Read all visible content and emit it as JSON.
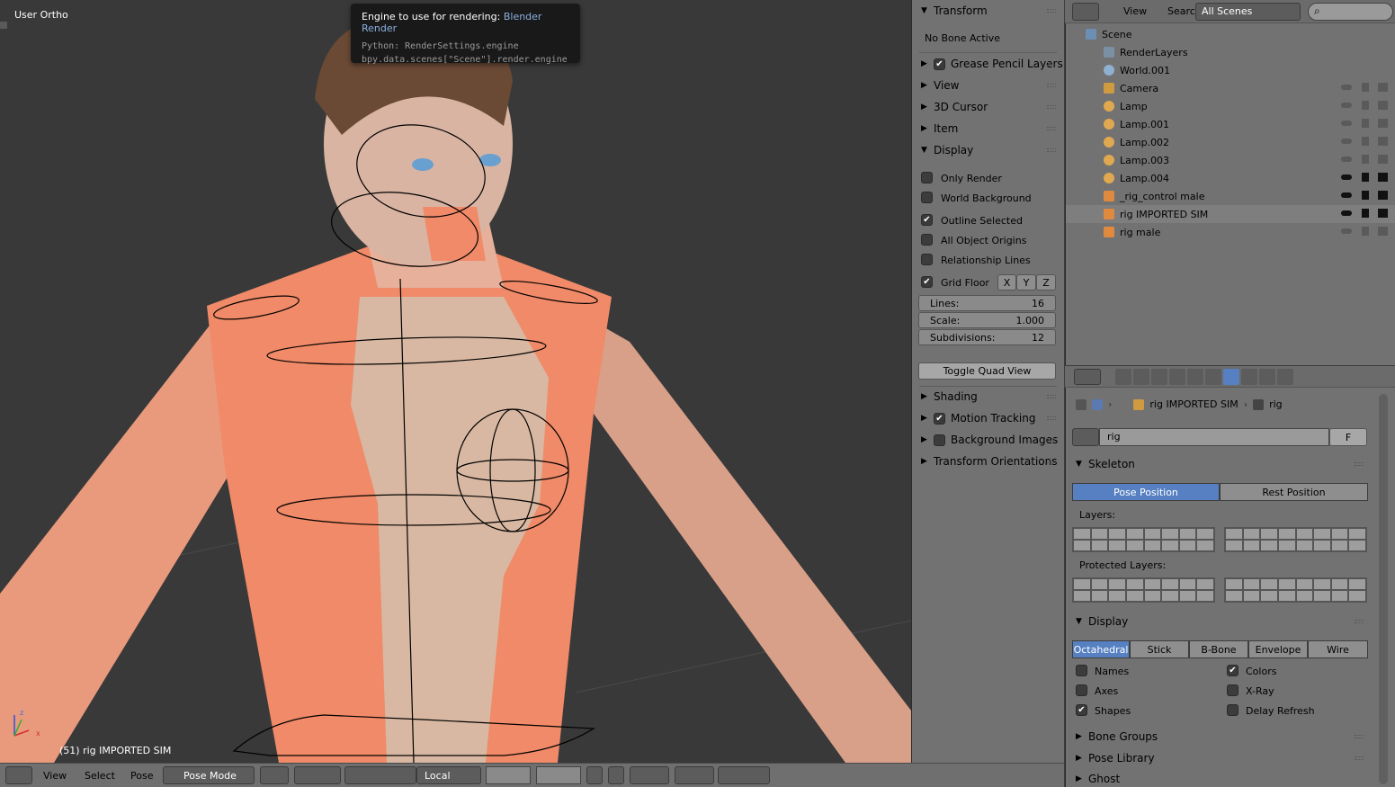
{
  "viewport": {
    "view_label": "User Ortho",
    "status": "(51) rig IMPORTED SIM"
  },
  "tooltip": {
    "title": "Engine to use for rendering:",
    "value": "Blender Render",
    "python1": "Python: RenderSettings.engine",
    "python2": "bpy.data.scenes[\"Scene\"].render.engine"
  },
  "npanel": {
    "transform": "Transform",
    "no_bone": "No Bone Active",
    "grease": "Grease Pencil Layers",
    "view": "View",
    "cursor": "3D Cursor",
    "item": "Item",
    "display": "Display",
    "only_render": "Only Render",
    "world_bg": "World Background",
    "outline_sel": "Outline Selected",
    "all_origins": "All Object Origins",
    "rel_lines": "Relationship Lines",
    "grid_floor": "Grid Floor",
    "axis_x": "X",
    "axis_y": "Y",
    "axis_z": "Z",
    "lines_label": "Lines:",
    "lines_val": "16",
    "scale_label": "Scale:",
    "scale_val": "1.000",
    "subdiv_label": "Subdivisions:",
    "subdiv_val": "12",
    "toggle_quad": "Toggle Quad View",
    "shading": "Shading",
    "motion": "Motion Tracking",
    "bg_images": "Background Images",
    "trans_orient": "Transform Orientations"
  },
  "outliner": {
    "view": "View",
    "search": "Search",
    "scenes": "All Scenes",
    "rows": [
      {
        "name": "Scene"
      },
      {
        "name": "RenderLayers"
      },
      {
        "name": "World.001"
      },
      {
        "name": "Camera"
      },
      {
        "name": "Lamp"
      },
      {
        "name": "Lamp.001"
      },
      {
        "name": "Lamp.002"
      },
      {
        "name": "Lamp.003"
      },
      {
        "name": "Lamp.004"
      },
      {
        "name": "_rig_control male"
      },
      {
        "name": "rig IMPORTED SIM"
      },
      {
        "name": "rig male"
      }
    ]
  },
  "props": {
    "crumb_obj": "rig IMPORTED SIM",
    "crumb_data": "rig",
    "datablock": "rig",
    "fake": "F",
    "skeleton": "Skeleton",
    "pose_pos": "Pose Position",
    "rest_pos": "Rest Position",
    "layers": "Layers:",
    "prot_layers": "Protected Layers:",
    "display": "Display",
    "octahedral": "Octahedral",
    "stick": "Stick",
    "bbone": "B-Bone",
    "envelope": "Envelope",
    "wire": "Wire",
    "names": "Names",
    "colors": "Colors",
    "axes": "Axes",
    "xray": "X-Ray",
    "shapes": "Shapes",
    "delay": "Delay Refresh",
    "bone_groups": "Bone Groups",
    "pose_lib": "Pose Library",
    "ghost": "Ghost"
  },
  "bottombar": {
    "view": "View",
    "select": "Select",
    "pose": "Pose",
    "mode": "Pose Mode",
    "orient": "Local"
  },
  "colors": {
    "accent": "#5680c2",
    "skin": "#f08a68"
  }
}
